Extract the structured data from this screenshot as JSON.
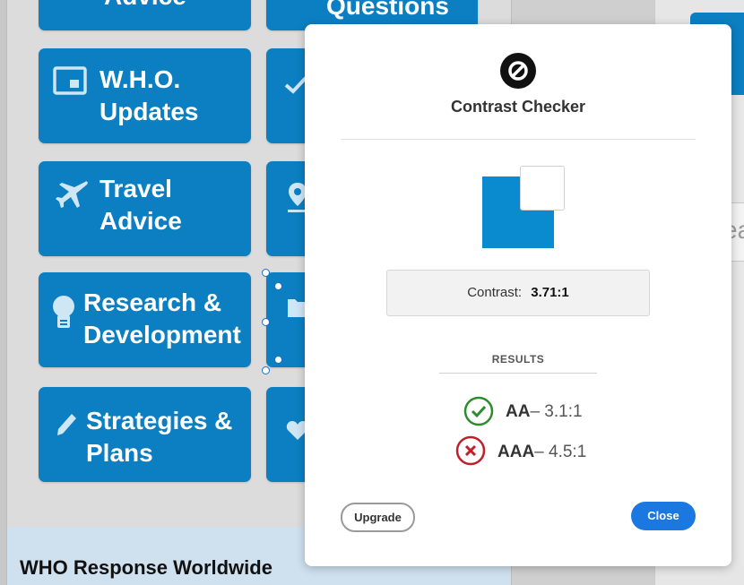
{
  "background": {
    "tiles": [
      {
        "label": "Advice"
      },
      {
        "label": "Questions"
      },
      {
        "label": "W.H.O.\nUpdates"
      },
      {
        "label": "Travel\nAdvice"
      },
      {
        "label": "Research &\nDevelopment"
      },
      {
        "label": "Strategies &\nPlans"
      }
    ],
    "section_title": "WHO Response Worldwide",
    "right_box_glyph": "ea"
  },
  "dialog": {
    "title": "Contrast Checker",
    "contrast_label": "Contrast:",
    "contrast_value": "3.71:1",
    "results_heading": "RESULTS",
    "results": [
      {
        "level": "AA",
        "requirement": "– 3.1:1",
        "status": "pass",
        "color": "#2e8b2e"
      },
      {
        "level": "AAA",
        "requirement": "– 4.5:1",
        "status": "fail",
        "color": "#c0202a"
      }
    ],
    "upgrade_label": "Upgrade",
    "close_label": "Close",
    "colors": {
      "background_swatch": "#0a8bd0",
      "foreground_swatch": "#ffffff",
      "accent": "#1a78e0"
    }
  }
}
